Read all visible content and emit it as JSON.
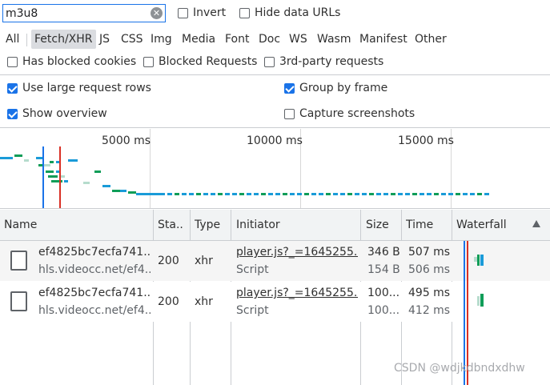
{
  "filter": {
    "value": "m3u8",
    "invert_label": "Invert",
    "hide_data_urls_label": "Hide data URLs"
  },
  "type_filters": [
    "All",
    "Fetch/XHR",
    "JS",
    "CSS",
    "Img",
    "Media",
    "Font",
    "Doc",
    "WS",
    "Wasm",
    "Manifest",
    "Other"
  ],
  "active_type": "Fetch/XHR",
  "blocking": {
    "blocked_cookies": "Has blocked cookies",
    "blocked_requests": "Blocked Requests",
    "third_party": "3rd-party requests"
  },
  "settings": {
    "large_rows": "Use large request rows",
    "group_by_frame": "Group by frame",
    "show_overview": "Show overview",
    "capture_screenshots": "Capture screenshots"
  },
  "overview": {
    "ticks": [
      "5000 ms",
      "10000 ms",
      "15000 ms"
    ]
  },
  "columns": {
    "name": "Name",
    "status": "Sta..",
    "type": "Type",
    "initiator": "Initiator",
    "size": "Size",
    "time": "Time",
    "waterfall": "Waterfall"
  },
  "rows": [
    {
      "name": "ef4825bc7ecfa741...",
      "host": "hls.videocc.net/ef4...",
      "status": "200",
      "type": "xhr",
      "initiator": "player.js?_=1645255...",
      "initiator_type": "Script",
      "size_transferred": "346 B",
      "size_resource": "154 B",
      "time_total": "507 ms",
      "time_latency": "506 ms"
    },
    {
      "name": "ef4825bc7ecfa741...",
      "host": "hls.videocc.net/ef4...",
      "status": "200",
      "type": "xhr",
      "initiator": "player.js?_=1645255...",
      "initiator_type": "Script",
      "size_transferred": "100...",
      "size_resource": "100...",
      "time_total": "495 ms",
      "time_latency": "412 ms"
    }
  ],
  "watermark": "CSDN @wdjkdbndxdhw",
  "colors": {
    "accent": "#1a73e8",
    "dom_content_loaded": "#1a73e8",
    "load_event": "#d93025",
    "waiting": "#0f9d58",
    "download": "#1a9bd8"
  }
}
